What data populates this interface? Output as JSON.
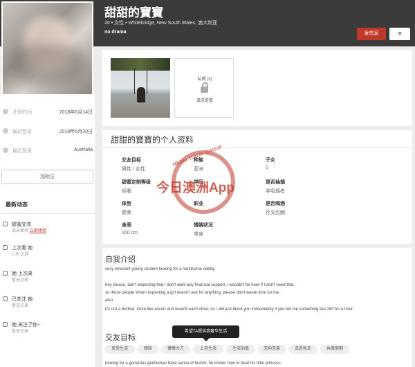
{
  "profile": {
    "name": "甜甜的寶寶",
    "subline": "20 • 女性 • Whitebridge, New South Wales, 澳大利亚",
    "tagline": "no drama",
    "message_button": "发信息",
    "like_icon": "heart-icon"
  },
  "sidebar": {
    "rows": [
      {
        "label": "注册时间",
        "value": "2018年6月14日"
      },
      {
        "label": "最近登录",
        "value": "2018年6月20日"
      },
      {
        "label": "最近登录",
        "value": "Australia"
      }
    ],
    "note_button": "加标注",
    "activity_title": "最新动态",
    "activities": [
      {
        "title": "甜蜜交流",
        "sub": "尚未体验",
        "link": "立即体验"
      },
      {
        "title": "上次看 她",
        "sub": "1 天 之前",
        "link": ""
      },
      {
        "title": "她 上次来",
        "sub": "暂无记录",
        "link": ""
      },
      {
        "title": "已关注 她",
        "sub": "暂无记录",
        "link": ""
      },
      {
        "title": "她 关注了你~",
        "sub": "暂无记录",
        "link": ""
      }
    ]
  },
  "gallery": {
    "private_label": "私照 (3)",
    "private_action": "请求查看"
  },
  "details": {
    "title": "甜甜的寶寶的个人资料",
    "fields": [
      {
        "label": "交友目标",
        "value": "男性 / 女性"
      },
      {
        "label": "种族",
        "value": "亚洲"
      },
      {
        "label": "子女",
        "value": "0"
      },
      {
        "label": "甜蜜定制等级",
        "value": "轻奢"
      },
      {
        "label": "学历",
        "value": ""
      },
      {
        "label": "是否抽烟",
        "value": "非吸烟者"
      },
      {
        "label": "体型",
        "value": "健美"
      },
      {
        "label": "职业",
        "value": ""
      },
      {
        "label": "是否喝酒",
        "value": "社交应酬"
      },
      {
        "label": "身高",
        "value": "160 cm"
      },
      {
        "label": "婚姻状况",
        "value": "单身"
      }
    ]
  },
  "watermark": {
    "ring_text": "MEDIA TODAY GROUP",
    "main_text": "今日澳洲App"
  },
  "intro": {
    "title": "自我介绍",
    "lines": [
      "sexy innocent young student looking for a handsome daddy.",
      "hey please, don't expecting that I don't want any financial support, i wouldn't be here if I don't need that.",
      "so those people whom expecting a girl doesn't ask for anything, please don't waste time on me.",
      "also.",
      "it's not a borthal, more like escort and benefit each other, so I will just block you immediately if you tell me something like 250 for a hour."
    ],
    "goals_title": "交友目标",
    "chips": [
      "享受生活",
      "暗昧",
      "慷慨大方",
      "上流生活",
      "生活加值",
      "无拘无束",
      "说走就走",
      "共度假期"
    ],
    "tooltip": "希望TA提供我奢华生活",
    "footer": "looking for a generous gentleman have sense of humor, he knows how to treat his little princess."
  }
}
